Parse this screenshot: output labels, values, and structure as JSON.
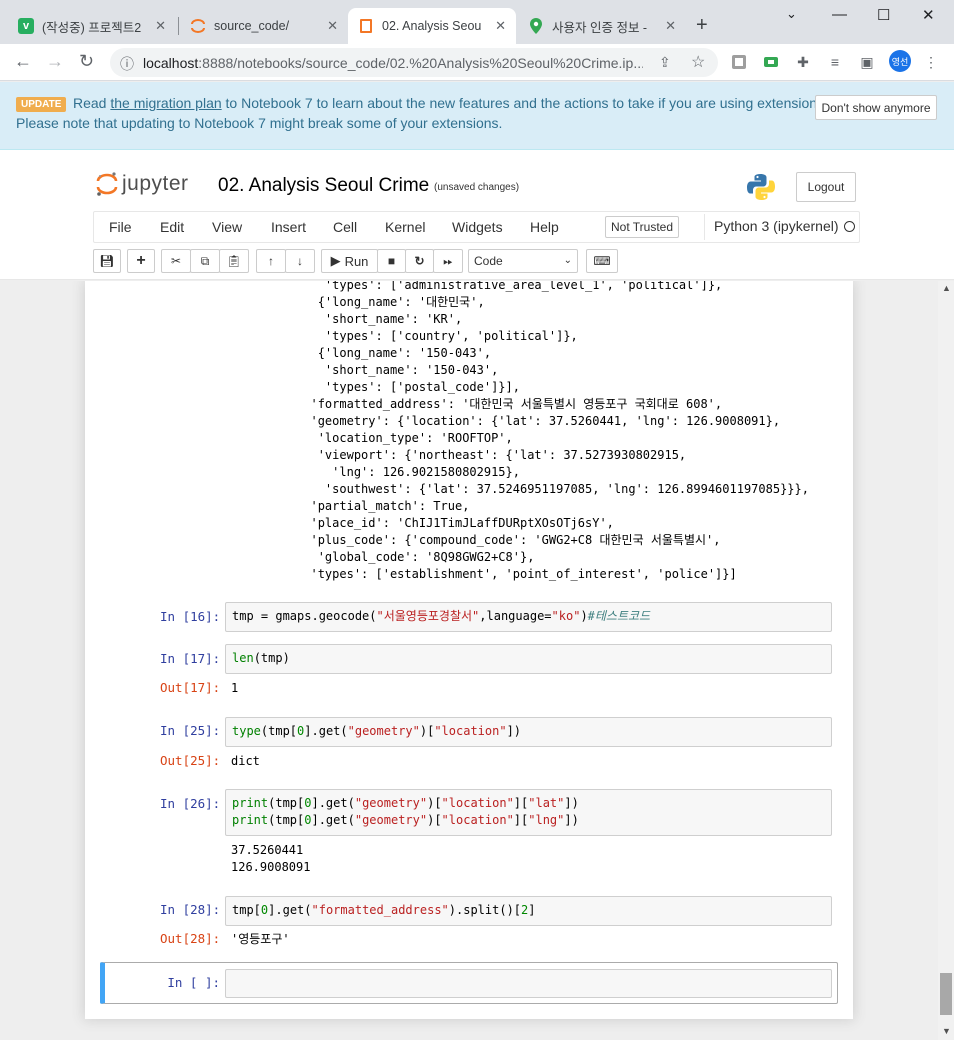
{
  "browser": {
    "tabs": [
      {
        "title": "(작성중) 프로젝트2",
        "icon": "v-icon"
      },
      {
        "title": "source_code/",
        "icon": "jupyter-icon"
      },
      {
        "title": "02. Analysis Seoul",
        "icon": "notebook-icon"
      },
      {
        "title": "사용자 인증 정보 -",
        "icon": "maps-icon"
      }
    ],
    "url_host": "localhost",
    "url_path": ":8888/notebooks/source_code/02.%20Analysis%20Seoul%20Crime.ip...",
    "profile": "영선"
  },
  "banner": {
    "badge": "UPDATE",
    "text_before": "Read ",
    "link": "the migration plan",
    "text_after": " to Notebook 7 to learn about the new features and the actions to take if you are using extensions -",
    "line2": "Please note that updating to Notebook 7 might break some of your extensions.",
    "dismiss": "Don't show anymore"
  },
  "header": {
    "logo": "jupyter",
    "title": "02. Analysis Seoul Crime",
    "status": "(unsaved changes)",
    "logout": "Logout"
  },
  "menu": {
    "items": [
      "File",
      "Edit",
      "View",
      "Insert",
      "Cell",
      "Kernel",
      "Widgets",
      "Help"
    ],
    "trust": "Not Trusted",
    "kernel": "Python 3 (ipykernel)"
  },
  "toolbar": {
    "run": "Run",
    "cell_type": "Code"
  },
  "prev_output": [
    "             'types': ['administrative_area_level_1', 'political']},",
    "            {'long_name': '대한민국',",
    "             'short_name': 'KR',",
    "             'types': ['country', 'political']},",
    "            {'long_name': '150-043',",
    "             'short_name': '150-043',",
    "             'types': ['postal_code']}],",
    "           'formatted_address': '대한민국 서울특별시 영등포구 국회대로 608',",
    "           'geometry': {'location': {'lat': 37.5260441, 'lng': 126.9008091},",
    "            'location_type': 'ROOFTOP',",
    "            'viewport': {'northeast': {'lat': 37.5273930802915,",
    "              'lng': 126.9021580802915},",
    "             'southwest': {'lat': 37.5246951197085, 'lng': 126.8994601197085}}},",
    "           'partial_match': True,",
    "           'place_id': 'ChIJ1TimJLaffDURptXOsOTj6sY',",
    "           'plus_code': {'compound_code': 'GWG2+C8 대한민국 서울특별시',",
    "            'global_code': '8Q98GWG2+C8'},",
    "           'types': ['establishment', 'point_of_interest', 'police']}]"
  ],
  "cells": {
    "c16": {
      "prompt": "In [16]:",
      "code_a": "tmp = gmaps.geocode(",
      "str1": "\"서울영등포경찰서\"",
      "code_b": ",language=",
      "str2": "\"ko\"",
      "code_c": ")",
      "comment": "#테스트코드"
    },
    "c17": {
      "prompt": "In [17]:",
      "builtin": "len",
      "code": "(tmp)",
      "out_prompt": "Out[17]:",
      "out": "1"
    },
    "c25": {
      "prompt": "In [25]:",
      "builtin": "type",
      "code_a": "(tmp[",
      "num": "0",
      "code_b": "].get(",
      "str1": "\"geometry\"",
      "code_c": ")[",
      "str2": "\"location\"",
      "code_d": "])",
      "out_prompt": "Out[25]:",
      "out": "dict"
    },
    "c26": {
      "prompt": "In [26]:",
      "line1": {
        "builtin": "print",
        "a": "(tmp[",
        "num": "0",
        "b": "].get(",
        "s1": "\"geometry\"",
        "c": ")[",
        "s2": "\"location\"",
        "d": "][",
        "s3": "\"lat\"",
        "e": "])"
      },
      "line2": {
        "builtin": "print",
        "a": "(tmp[",
        "num": "0",
        "b": "].get(",
        "s1": "\"geometry\"",
        "c": ")[",
        "s2": "\"location\"",
        "d": "][",
        "s3": "\"lng\"",
        "e": "])"
      },
      "out": "37.5260441\n126.9008091"
    },
    "c28": {
      "prompt": "In [28]:",
      "code_a": "tmp[",
      "num": "0",
      "code_b": "].get(",
      "str1": "\"formatted_address\"",
      "code_c": ").split()[",
      "num2": "2",
      "code_d": "]",
      "out_prompt": "Out[28]:",
      "out": "'영등포구'"
    },
    "empty": {
      "prompt": "In [ ]:"
    }
  }
}
